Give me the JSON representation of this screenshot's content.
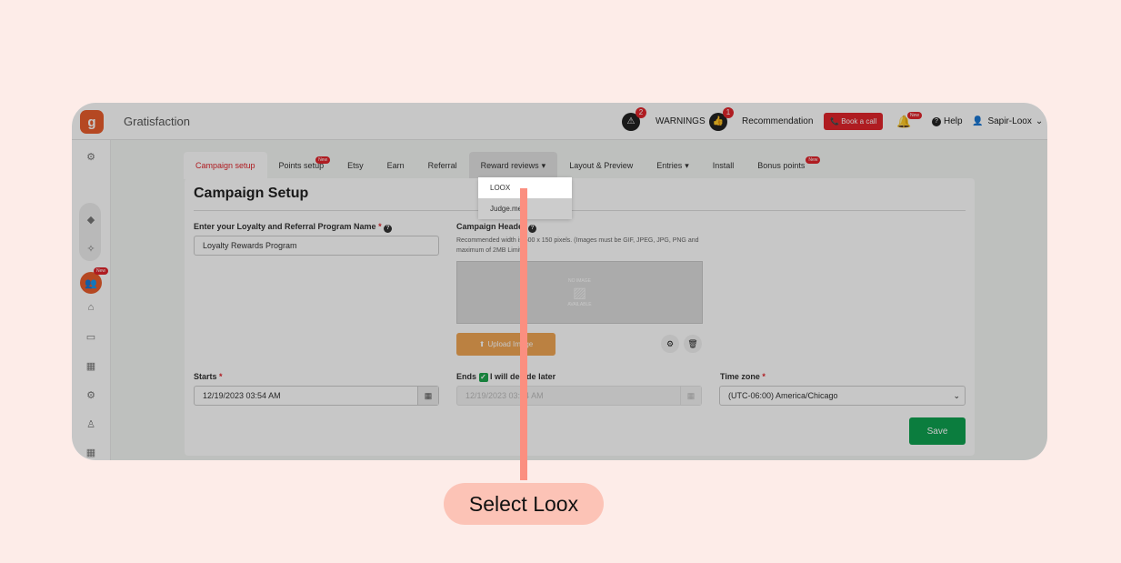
{
  "topbar": {
    "brand": "Gratisfaction",
    "warnings_count": "2",
    "warnings_label": "WARNINGS",
    "recommendation_count": "1",
    "recommendation_label": "Recommendation",
    "book_call": "Book a call",
    "new_badge": "New",
    "help": "Help",
    "user": "Sapir-Loox"
  },
  "sidebar": {
    "new_badge": "New"
  },
  "tabs": [
    {
      "label": "Campaign setup"
    },
    {
      "label": "Points setup",
      "badge": "New"
    },
    {
      "label": "Etsy"
    },
    {
      "label": "Earn"
    },
    {
      "label": "Referral"
    },
    {
      "label": "Reward reviews"
    },
    {
      "label": "Layout & Preview"
    },
    {
      "label": "Entries"
    },
    {
      "label": "Install"
    },
    {
      "label": "Bonus points",
      "badge": "New"
    }
  ],
  "dropdown": {
    "items": [
      "LOOX",
      "Judge.me"
    ]
  },
  "card": {
    "title": "Campaign Setup",
    "program_label": "Enter your Loyalty and Referral Program Name",
    "program_value": "Loyalty Rewards Program",
    "header_label": "Campaign Header",
    "header_hint": "Recommended width is 600 x 150 pixels. (Images must be GIF, JPEG, JPG, PNG and maximum of 2MB Limit).",
    "no_image_top": "NO IMAGE",
    "no_image_bottom": "AVAILABLE",
    "upload_label": "Upload Image",
    "starts_label": "Starts",
    "starts_value": "12/19/2023 03:54 AM",
    "ends_label": "Ends",
    "ends_check_label": "I will decide later",
    "ends_value": "12/19/2023 03:54 AM",
    "timezone_label": "Time zone",
    "timezone_value": "(UTC-06:00) America/Chicago",
    "save": "Save"
  },
  "callout": {
    "text": "Select Loox"
  },
  "colors": {
    "accent": "#e0242b",
    "brand": "#e85d2c",
    "save": "#0fa050",
    "callout": "#fcc3b6",
    "pointer": "#fb8f80"
  }
}
